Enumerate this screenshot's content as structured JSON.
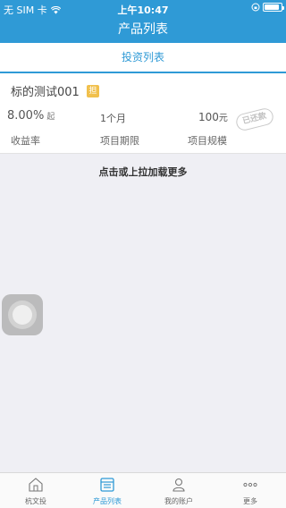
{
  "status_bar": {
    "carrier": "无 SIM 卡",
    "time": "上午10:47",
    "battery_level": 0.9
  },
  "nav": {
    "title": "产品列表"
  },
  "tabs": {
    "active_label": "投资列表"
  },
  "product": {
    "title": "标的测试001",
    "tag": "担",
    "rate": "8.00%",
    "rate_suffix": "起",
    "term": "1个月",
    "scale_amount": "100",
    "scale_unit": "元",
    "stamp": "已还款",
    "rate_label": "收益率",
    "term_label": "项目期限",
    "scale_label": "项目规模"
  },
  "load_more": "点击或上拉加载更多",
  "bottom_tabs": [
    {
      "label": "杭文投",
      "icon": "home-icon"
    },
    {
      "label": "产品列表",
      "icon": "list-icon",
      "active": true
    },
    {
      "label": "我的账户",
      "icon": "user-icon"
    },
    {
      "label": "更多",
      "icon": "more-icon"
    }
  ],
  "colors": {
    "primary": "#2f9ad6",
    "background": "#efeff4",
    "tag": "#f1c04c"
  }
}
